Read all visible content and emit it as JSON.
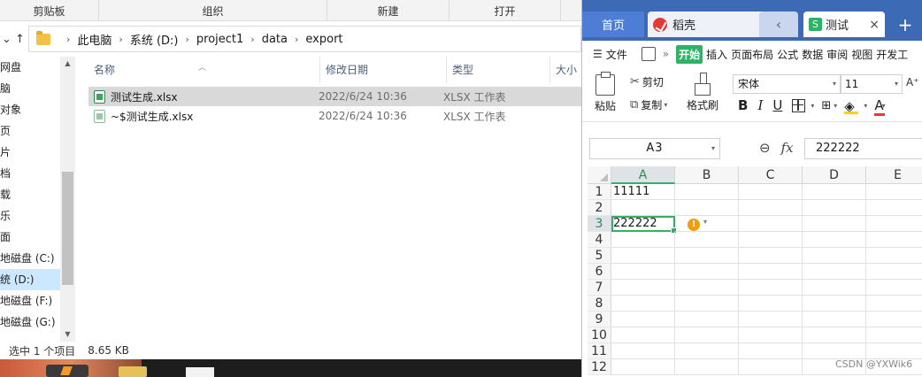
{
  "explorer": {
    "ribbon_groups": [
      "剪贴板",
      "组织",
      "新建",
      "打开"
    ],
    "breadcrumb": [
      "此电脑",
      "系统 (D:)",
      "project1",
      "data",
      "export"
    ],
    "nav_pane": [
      "网盘",
      "脑",
      "对象",
      "页",
      "片",
      "档",
      "载",
      "乐",
      "面",
      "地磁盘 (C:)",
      "统 (D:)",
      "地磁盘 (F:)",
      "地磁盘 (G:)"
    ],
    "columns": {
      "name": "名称",
      "date": "修改日期",
      "type": "类型",
      "size": "大小"
    },
    "files": [
      {
        "name": "测试生成.xlsx",
        "date": "2022/6/24 10:36",
        "type": "XLSX 工作表",
        "selected": true
      },
      {
        "name": "~$测试生成.xlsx",
        "date": "2022/6/24 10:36",
        "type": "XLSX 工作表",
        "selected": false
      }
    ],
    "status": {
      "selected": "选中 1 个项目",
      "size": "8.65 KB"
    }
  },
  "wps": {
    "tabs": {
      "home": "首页",
      "shell": "稻壳",
      "doc": "测试",
      "doc_icon": "S",
      "plus": "+",
      "back": "‹",
      "close": "×"
    },
    "menu": {
      "file": "文件",
      "active": "开始",
      "items": [
        "插入",
        "页面布局",
        "公式",
        "数据",
        "审阅",
        "视图",
        "开发工"
      ]
    },
    "tools": {
      "paste": "粘贴",
      "cut": "剪切",
      "copy": "复制",
      "format_painter": "格式刷",
      "font": "宋体",
      "size": "11"
    },
    "formula": {
      "cell_ref": "A3",
      "value": "222222"
    },
    "columns": [
      "A",
      "B",
      "C",
      "D",
      "E"
    ],
    "rows": [
      "1",
      "2",
      "3",
      "4",
      "5",
      "6",
      "7",
      "8",
      "9",
      "10",
      "11",
      "12"
    ],
    "cells": {
      "A1": "11111",
      "A3": "222222"
    },
    "accent": "#2fb266",
    "tab_blue": "#3d6ab5"
  },
  "watermark": "CSDN @YXWik6"
}
